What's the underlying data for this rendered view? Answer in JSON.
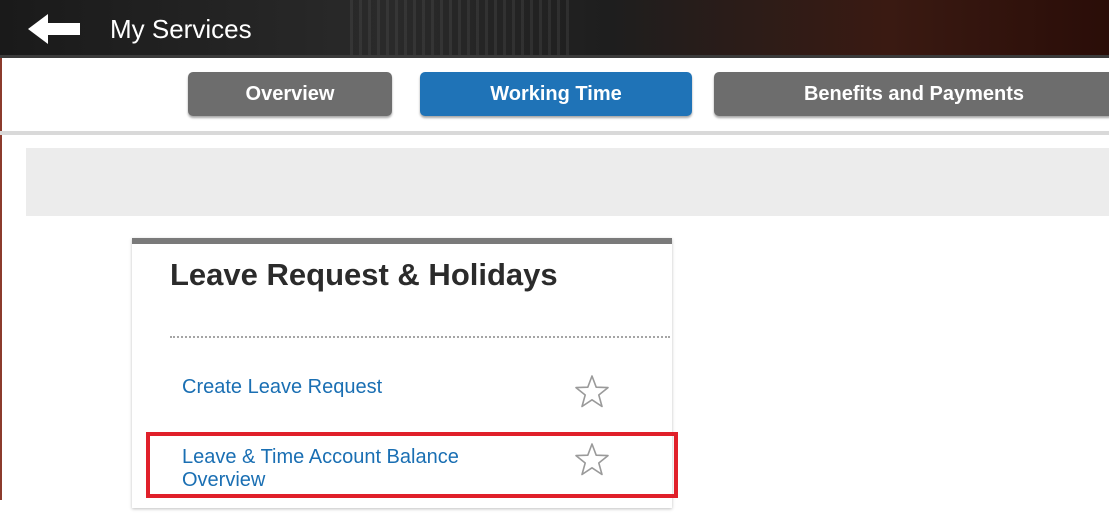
{
  "header": {
    "title": "My Services",
    "back_icon": "back-arrow-icon"
  },
  "tabs": [
    {
      "label": "Overview",
      "active": false
    },
    {
      "label": "Working Time",
      "active": true
    },
    {
      "label": "Benefits and Payments",
      "active": false
    }
  ],
  "card": {
    "title": "Leave Request & Holidays",
    "items": [
      {
        "label": "Create Leave Request",
        "icon": "star-icon"
      },
      {
        "label": "Leave & Time Account Balance Overview",
        "icon": "star-icon",
        "highlighted": true
      }
    ]
  },
  "colors": {
    "active_tab": "#1f73b7",
    "inactive_tab": "#6d6d6d",
    "link": "#1a6fb3",
    "highlight": "#e0202a"
  }
}
